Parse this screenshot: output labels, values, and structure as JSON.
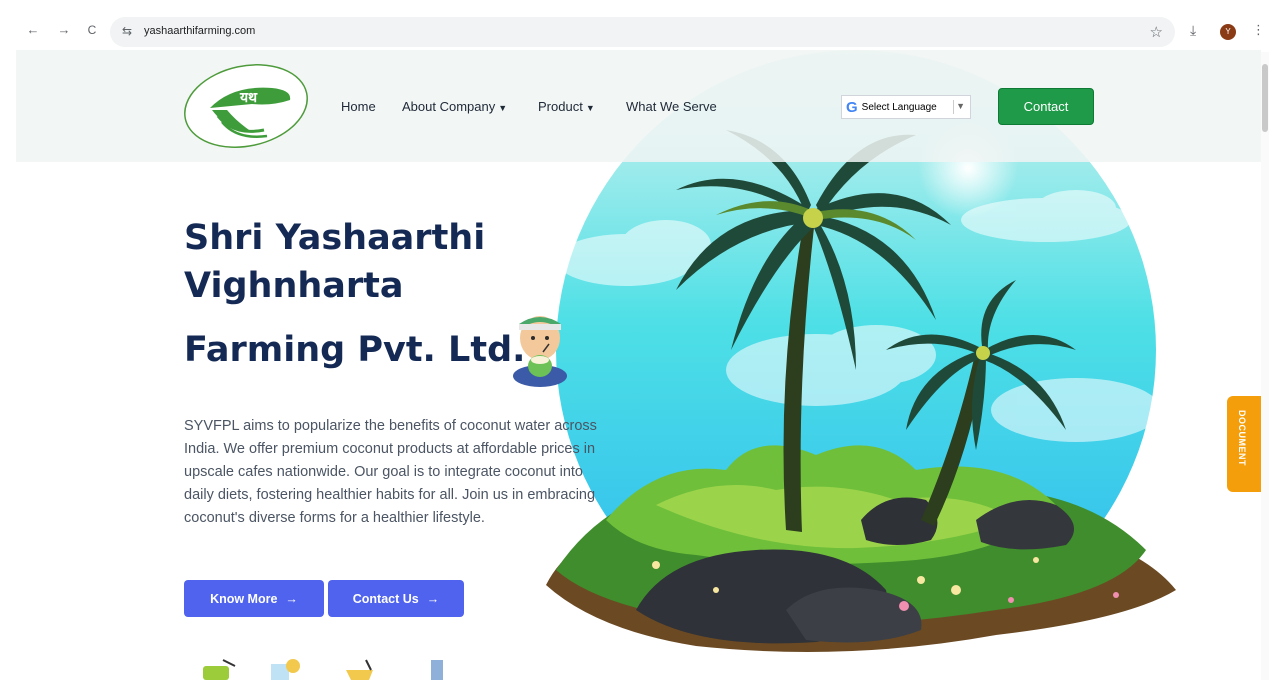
{
  "browser": {
    "back_icon": "←",
    "forward_icon": "→",
    "reload_icon": "C",
    "url": "yashaarthifarming.com",
    "profile_initial": "Y",
    "colors": {
      "omnibox": "#f1f3f4"
    }
  },
  "header": {
    "nav": [
      {
        "label": "Home",
        "has_caret": false
      },
      {
        "label": "About Company",
        "has_caret": true
      },
      {
        "label": "Product",
        "has_caret": true
      },
      {
        "label": "What We Serve",
        "has_caret": false
      }
    ],
    "language_label": "Select Language",
    "contact_label": "Contact"
  },
  "hero": {
    "title_line1": "Shri Yashaarthi",
    "title_line2": "Vighnharta",
    "title_line3": "Farming Pvt. Ltd.",
    "description": "SYVFPL aims to popularize the benefits of coconut water across India. We offer premium coconut products at affordable prices in upscale cafes nationwide. Our goal is to integrate coconut into daily diets, fostering healthier habits for all. Join us in embracing coconut's diverse forms for a healthier lifestyle.",
    "know_more_label": "Know More",
    "contact_us_label": "Contact Us",
    "arrow": "→"
  },
  "side_tab": {
    "label": "DOCUMENT"
  },
  "colors": {
    "brand_green": "#1e9a48",
    "title_navy": "#142a55",
    "button_blue": "#4f63ee",
    "document_orange": "#f59e0b"
  }
}
